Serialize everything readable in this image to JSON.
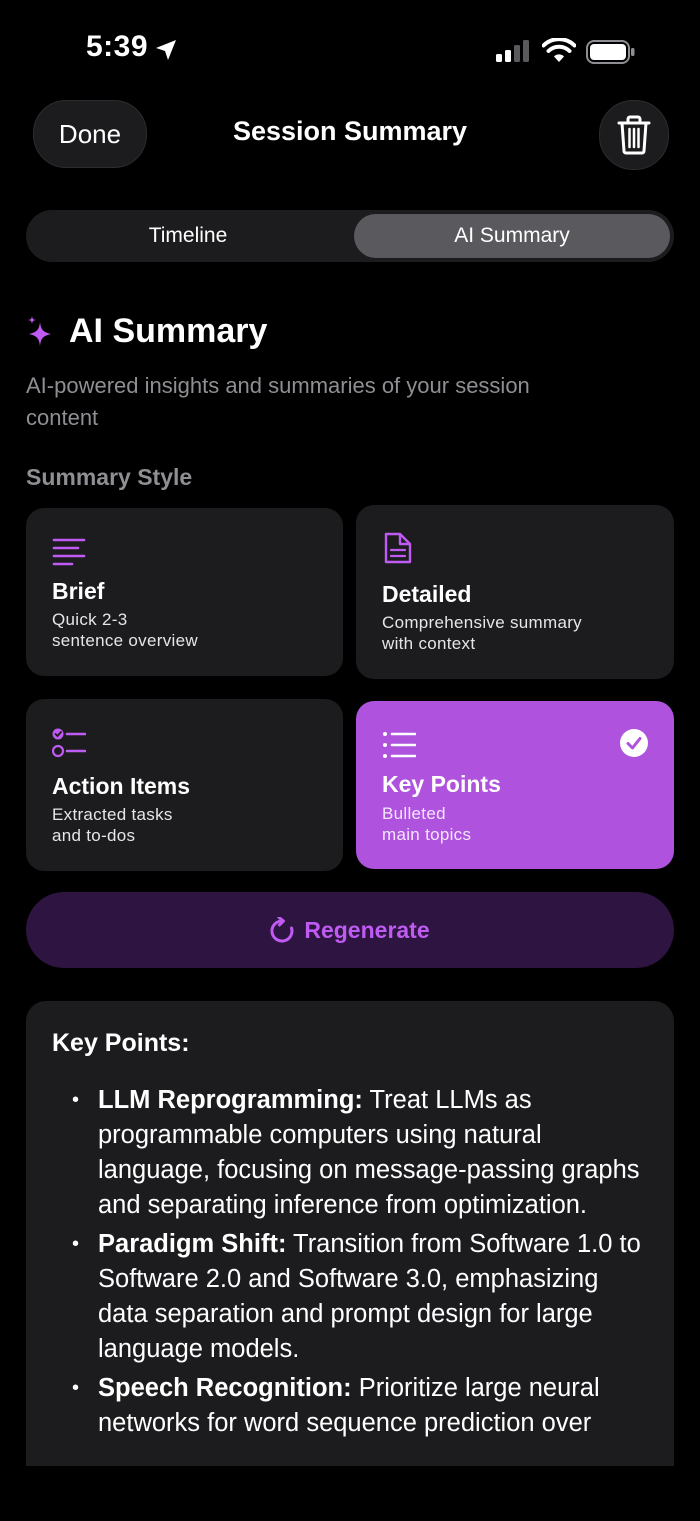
{
  "status_bar": {
    "time": "5:39"
  },
  "header": {
    "done_label": "Done",
    "title": "Session Summary"
  },
  "tabs": [
    {
      "label": "Timeline",
      "selected": false
    },
    {
      "label": "AI Summary",
      "selected": true
    }
  ],
  "section": {
    "title": "AI Summary",
    "subtitle": "AI-powered insights and summaries of your session content",
    "style_label": "Summary Style"
  },
  "styles": [
    {
      "name": "Brief",
      "description": "Quick 2-3\nsentence overview",
      "icon": "lines-icon",
      "selected": false
    },
    {
      "name": "Detailed",
      "description": "Comprehensive summary\nwith context",
      "icon": "document-icon",
      "selected": false
    },
    {
      "name": "Action Items",
      "description": "Extracted tasks\nand to-dos",
      "icon": "checklist-icon",
      "selected": false
    },
    {
      "name": "Key Points",
      "description": "Bulleted\nmain topics",
      "icon": "bullet-list-icon",
      "selected": true
    }
  ],
  "regenerate_label": "Regenerate",
  "summary": {
    "heading": "Key Points:",
    "points": [
      {
        "title": "LLM Reprogramming:",
        "text": " Treat LLMs as programmable computers using natural language, focusing on message-passing graphs and separating inference from optimization."
      },
      {
        "title": "Paradigm Shift:",
        "text": " Transition from Software 1.0 to Software 2.0 and Software 3.0, emphasizing data separation and prompt design for large language models."
      },
      {
        "title": "Speech Recognition:",
        "text": " Prioritize large neural networks for word sequence prediction over"
      }
    ]
  },
  "colors": {
    "accent": "#af52de",
    "accent_text": "#bf5af2",
    "regenerate_bg": "#2e1440",
    "card_bg": "#1c1c1e",
    "background": "#000000"
  }
}
